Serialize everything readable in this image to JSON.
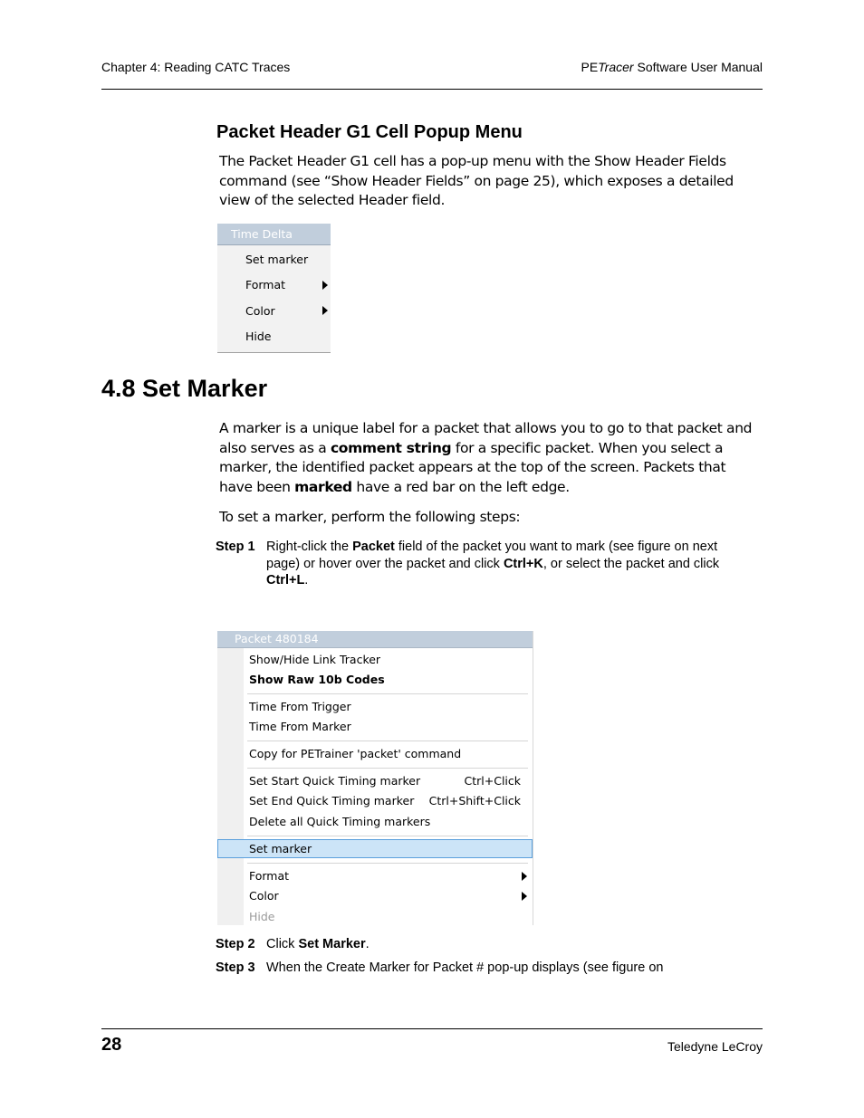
{
  "header": {
    "chapter": "Chapter 4: Reading CATC Traces",
    "manual_prefix": "PE",
    "manual_italic": "Tracer",
    "manual_suffix": " Software User Manual"
  },
  "section_popup": {
    "title": "Packet Header G1 Cell Popup Menu",
    "body": "The Packet Header G1 cell has a pop-up menu with the Show Header Fields command (see “Show Header Fields” on page 25), which exposes a detailed view of the selected Header field."
  },
  "menu_time_delta": {
    "title": "Time Delta",
    "items": [
      {
        "label": "Set marker",
        "submenu": false
      },
      {
        "label": "Format",
        "submenu": true
      },
      {
        "label": "Color",
        "submenu": true
      },
      {
        "label": "Hide",
        "submenu": false
      }
    ]
  },
  "section_marker": {
    "title": "4.8 Set Marker",
    "para1_a": "A marker is a unique label for a packet that allows you to go to that packet and also serves as a ",
    "para1_b1": "comment string",
    "para1_c": " for a specific packet. When you select a marker, the identified packet appears at the top of the screen. Packets that have been ",
    "para1_b2": "marked",
    "para1_d": " have a red bar on the left edge.",
    "para2": "To set a marker, perform the following steps:"
  },
  "steps": [
    {
      "label": "Step 1",
      "t1": "Right-click the ",
      "b1": "Packet",
      "t2": " field of the packet you want to mark (see figure on next page) or hover over the packet and click ",
      "b2": "Ctrl+K",
      "t3": ", or select the packet and click ",
      "b3": "Ctrl+L",
      "t4": "."
    },
    {
      "label": "Step 2",
      "t1": "Click ",
      "b1": "Set Marker",
      "t2": "."
    },
    {
      "label": "Step 3",
      "t1": "When the Create Marker for Packet # pop-up displays (see figure on"
    }
  ],
  "menu_packet": {
    "title": "Packet 480184",
    "items": [
      {
        "label": "Show/Hide Link Tracker"
      },
      {
        "label": "Show Raw 10b Codes",
        "bold": true
      },
      {
        "label": "Time From Trigger"
      },
      {
        "label": "Time From Marker"
      },
      {
        "label": "Copy for PETrainer 'packet' command"
      },
      {
        "label": "Set Start Quick Timing marker",
        "shortcut": "Ctrl+Click"
      },
      {
        "label": "Set End Quick Timing marker",
        "shortcut": "Ctrl+Shift+Click"
      },
      {
        "label": "Delete all Quick Timing markers"
      },
      {
        "label": "Set marker",
        "highlighted": true
      },
      {
        "label": "Format",
        "submenu": true
      },
      {
        "label": "Color",
        "submenu": true
      },
      {
        "label": "Hide",
        "disabled": true
      }
    ]
  },
  "footer": {
    "page_number": "28",
    "company": "Teledyne LeCroy"
  }
}
